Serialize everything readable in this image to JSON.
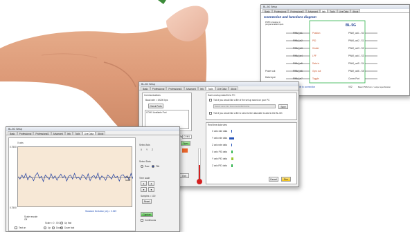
{
  "brand": {
    "background": "#ffffff",
    "plot_bg": "#f7e8d6",
    "signal": "#1f3ea3",
    "accent_green": "#2db34a",
    "accent_orange": "#e9642a",
    "accent_blue": "#2653b8",
    "accent_yellow": "#f2c318"
  },
  "icons": [
    "close-icon",
    "checkbox-icon",
    "radio-icon",
    "color-swatch-icon",
    "arrow-right-icon"
  ],
  "windowA": {
    "title": "BL-5G Setup",
    "tabs": [
      "Basic",
      "Professional",
      "Professional2",
      "Advanced",
      "Info",
      "Tools",
      "Live Data",
      "About"
    ],
    "heading": "Connection and functions diagram",
    "chip_label": "BL-5G",
    "power_label": "Power out",
    "note_left": "PWM in/analog in programmable inputs",
    "inputs": [
      "PWM_in1",
      "PWM_in2",
      "PWM_in3",
      "PWM_in4",
      "PWM_in5",
      "PWM_in6",
      "PWM_in7"
    ],
    "functions": [
      "Position",
      "PID",
      "Heater",
      "LPF",
      "Data in",
      "Gyro out",
      "Toggle"
    ],
    "outputs": [
      "PWM_out1 - S0",
      "PWM_out2 - S1",
      "PWM_out3 - S2",
      "PWM_out4 - S3",
      "PWM_out5 - S4",
      "PWM_out6 - S5"
    ],
    "extra_io": [
      "Comm Port",
      "Data input"
    ],
    "status_text": "BL-5G no errors - available to connection",
    "version_text": "V02",
    "legend_title": "Basic PWM form / output specification"
  },
  "windowB": {
    "title": "BL-5G Setup",
    "tabs": [
      "Basic",
      "Professional",
      "Professional2",
      "Advanced",
      "Info",
      "Tools",
      "Live Data",
      "About"
    ],
    "comm_heading": "Communications",
    "baud_label": "Baud rate = 19200 bps",
    "check_ports": "Check Ports",
    "port_item": "COM1 Available Port",
    "select_port_label": "Select Port",
    "select_port_value": "COM1",
    "close_btn": "Close",
    "open_btn": "Open",
    "save_heading": "Save a setup data file to PC",
    "save_tick": "Tick if you would like a file of the set up saved on your PC",
    "save_path": "Select save file: Documents/BL5G/file",
    "save_btn": "Save",
    "read_tick": "Tick if you would like a file to send to the data able to add to the BL-5G",
    "live_heading": "Real time data view",
    "live_rows": [
      "X axis rate data",
      "Y axis rate data",
      "Z axis rate data",
      "X axis PID data",
      "Y axis PID data",
      "Z axis PID data"
    ],
    "cancel_btn": "Cancel",
    "run_btn": "Run",
    "exit_btn": "Exit"
  },
  "windowC": {
    "title": "BL-5G Setup",
    "tabs": [
      "Basic",
      "Professional",
      "Professional2",
      "Advanced",
      "Info",
      "Tools",
      "Live Data",
      "About"
    ],
    "y_label": "X axis",
    "y_top": "0.7500",
    "y_bottom": "0.7500",
    "x_label": "Time scale",
    "std_dev": "Standard Deviation (dc) =  0.369",
    "select_axis": "Select Axis",
    "axes": [
      "X",
      "Y",
      "Z"
    ],
    "select_data": "Select Data",
    "data_options": [
      "Raw",
      "Filtr"
    ],
    "time_scale": "Time scale",
    "samples": "Samples = 100",
    "reset_btn": "Reset",
    "capture_btn": "Capture",
    "continuous": "Continuous",
    "scale_heading": "Scale rescale",
    "scale_value": "Scale = 0 . 001  25",
    "scale_options": [
      "Up fast",
      "Down fast",
      "Up",
      "Down"
    ],
    "test_on": "Test on",
    "off_label": "Off"
  },
  "chart_data": {
    "type": "line",
    "xlabel": "Time scale",
    "ylabel": "X axis",
    "ylim": [
      -0.75,
      0.75
    ],
    "series": [
      {
        "values": [
          0.02,
          -0.04,
          0.06,
          -0.02,
          0.1,
          -0.06,
          0.04,
          0.0,
          -0.08,
          0.05,
          0.12,
          -0.02,
          0.03,
          -0.1,
          0.06,
          0.01,
          -0.05,
          0.09,
          -0.03,
          0.04,
          -0.07,
          0.02,
          0.08,
          -0.01,
          0.05,
          -0.09,
          0.03,
          0.06,
          -0.04,
          0.1,
          -0.02,
          0.01,
          -0.06,
          0.07,
          0.03,
          -0.05,
          0.09,
          -0.08,
          0.02,
          0.05,
          -0.03,
          0.11,
          -0.06,
          0.04,
          0.0,
          -0.07,
          0.06,
          0.02,
          -0.04,
          0.08,
          -0.01,
          0.03,
          -0.09,
          0.05,
          0.07,
          -0.02,
          0.04,
          -0.06,
          0.1,
          -0.03
        ]
      }
    ]
  }
}
